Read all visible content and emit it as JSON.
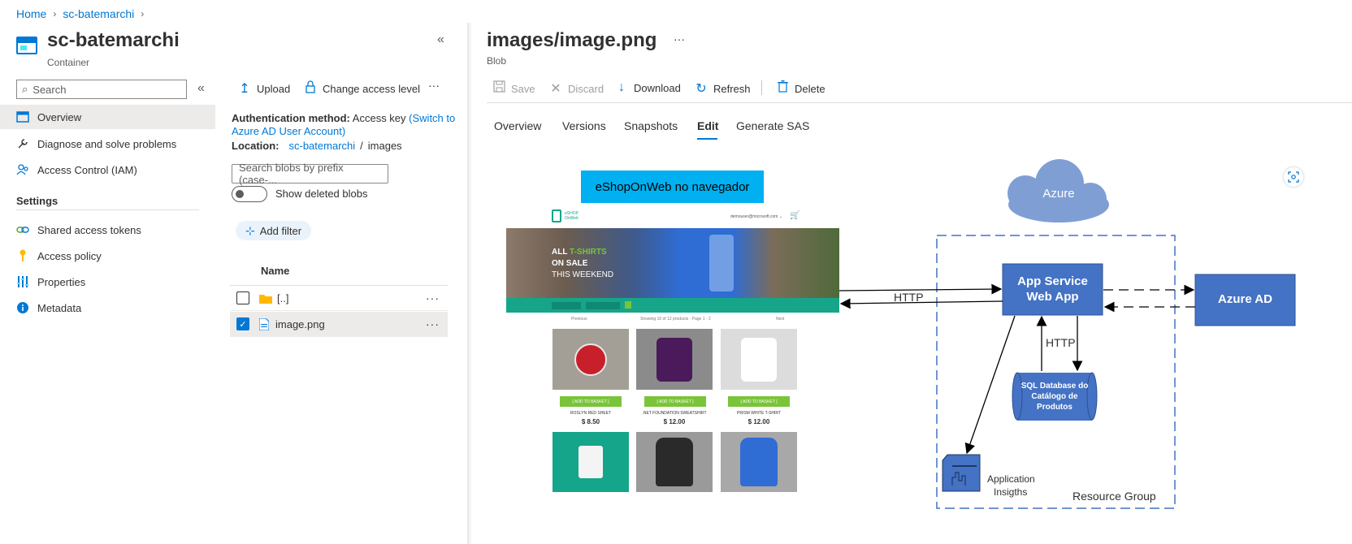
{
  "breadcrumb": {
    "home": "Home",
    "container": "sc-batemarchi"
  },
  "left_blade": {
    "title": "sc-batemarchi",
    "subtitle": "Container",
    "collapse": "«",
    "search_placeholder": "Search",
    "nav": [
      {
        "label": "Overview",
        "icon": "overview-icon",
        "active": true
      },
      {
        "label": "Diagnose and solve problems",
        "icon": "wrench-icon"
      },
      {
        "label": "Access Control (IAM)",
        "icon": "people-icon"
      }
    ],
    "settings_header": "Settings",
    "settings": [
      {
        "label": "Shared access tokens",
        "icon": "link-icon"
      },
      {
        "label": "Access policy",
        "icon": "key-icon"
      },
      {
        "label": "Properties",
        "icon": "properties-icon"
      },
      {
        "label": "Metadata",
        "icon": "info-icon"
      }
    ]
  },
  "container_pane": {
    "toolbar": {
      "upload": "Upload",
      "change_access": "Change access level",
      "more": "···"
    },
    "auth_label": "Authentication method:",
    "auth_value": "Access key",
    "auth_switch_1": "(Switch to",
    "auth_switch_2": "Azure AD User Account)",
    "location_label": "Location:",
    "location_link": "sc-batemarchi",
    "location_sep": "/",
    "location_path": "images",
    "search_blobs_placeholder": "Search blobs by prefix (case-...",
    "show_deleted": "Show deleted blobs",
    "add_filter": "Add filter",
    "column_name": "Name",
    "rows": [
      {
        "name": "[..]",
        "type": "folder",
        "selected": false
      },
      {
        "name": "image.png",
        "type": "file",
        "selected": true
      }
    ]
  },
  "blob_blade": {
    "title": "images/image.png",
    "more": "···",
    "subtitle": "Blob",
    "toolbar": {
      "save": "Save",
      "discard": "Discard",
      "download": "Download",
      "refresh": "Refresh",
      "delete": "Delete"
    },
    "tabs": [
      "Overview",
      "Versions",
      "Snapshots",
      "Edit",
      "Generate SAS"
    ],
    "active_tab": "Edit"
  },
  "diagram": {
    "eshop_label": "eShopOnWeb no navegador",
    "azure_cloud": "Azure",
    "app_service": [
      "App Service",
      "Web App"
    ],
    "azure_ad": "Azure AD",
    "http_main": "HTTP",
    "http_db": "HTTP",
    "sql_db": [
      "SQL Database do",
      "Catálogo de",
      "Produtos"
    ],
    "app_insights": [
      "Application",
      "Insigths"
    ],
    "resource_group": "Resource Group",
    "shop": {
      "header_user": "demouser@microsoft.com ⌄",
      "banner_1": "ALL",
      "banner_1b": "T-SHIRTS",
      "banner_2": "ON SALE",
      "banner_3": "THIS WEEKEND",
      "nav_prev": "Previous",
      "nav_info": "Showing 10 of 12 products - Page 1 - 2",
      "nav_next": "Next",
      "add_to_basket": "[ ADD TO BASKET ]",
      "products": [
        {
          "name": "ROSLYN RED SHEET",
          "price": "$ 8.50"
        },
        {
          "name": ".NET FOUNDATION SWEATSHIRT",
          "price": "$ 12.00"
        },
        {
          "name": "PRISM WHITE T-SHIRT",
          "price": "$ 12.00"
        }
      ]
    }
  },
  "colors": {
    "accent": "#0078d4",
    "diagram_blue": "#4472c4",
    "cloud": "#7f9fd4",
    "eshop_label_bg": "#00b0f0",
    "shop_teal": "#17a589",
    "shop_green": "#7ac43a"
  }
}
